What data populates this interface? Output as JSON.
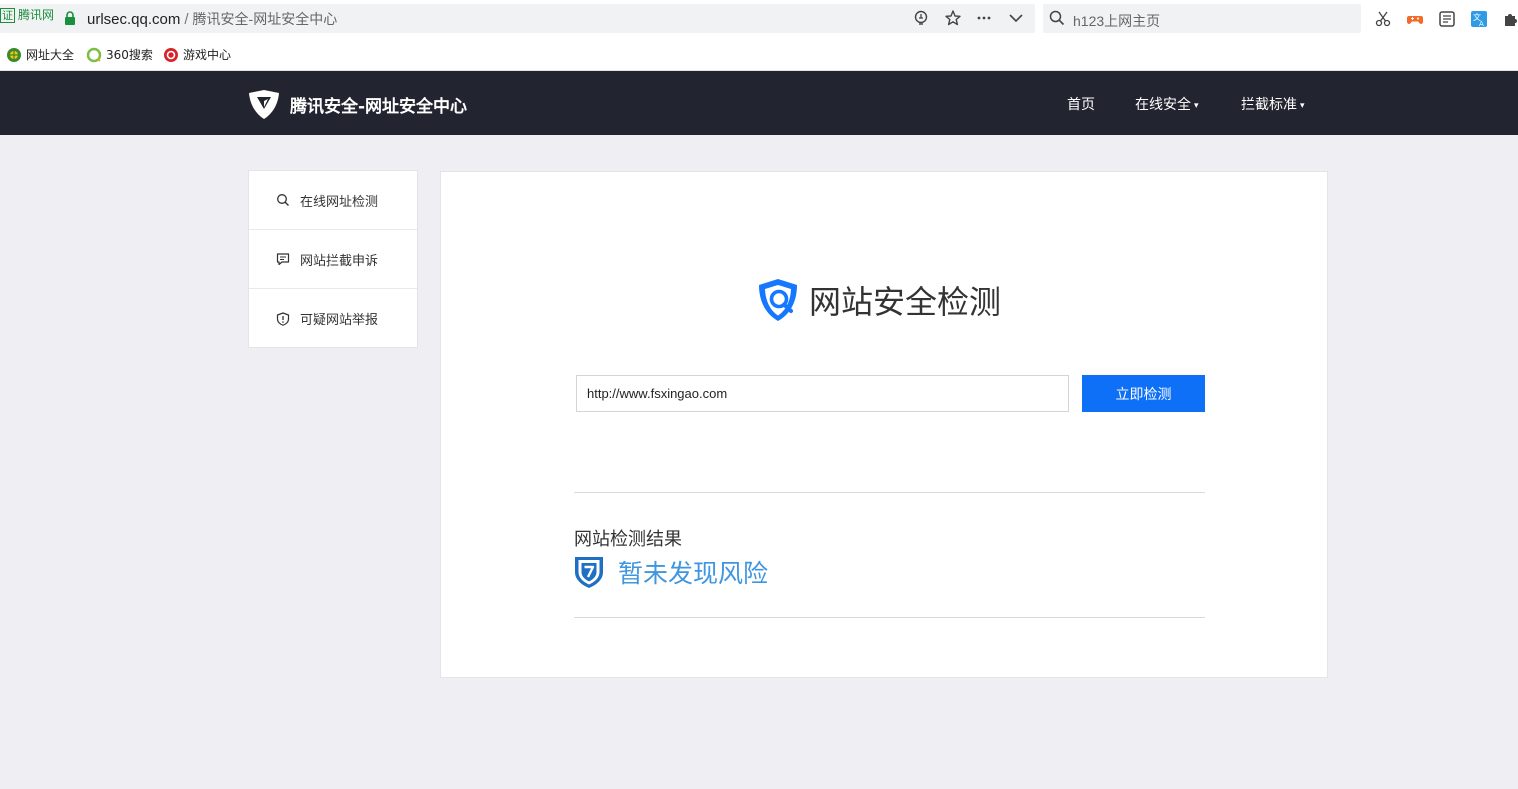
{
  "browser": {
    "cert_label": "腾讯网",
    "cert_box": "证",
    "url_domain": "urlsec.qq.com",
    "url_separator": "/",
    "page_title": "腾讯安全-网址安全中心",
    "search_placeholder": "h123上网主页"
  },
  "bookmarks": [
    {
      "label": "网址大全"
    },
    {
      "label": "360搜索"
    },
    {
      "label": "游戏中心"
    }
  ],
  "header": {
    "logo_text": "腾讯安全-网址安全中心",
    "nav": [
      {
        "label": "首页"
      },
      {
        "label": "在线安全"
      },
      {
        "label": "拦截标准"
      }
    ],
    "caret": "▾"
  },
  "sidebar": {
    "items": [
      {
        "label": "在线网址检测",
        "icon": "search-icon"
      },
      {
        "label": "网站拦截申诉",
        "icon": "comment-icon"
      },
      {
        "label": "可疑网站举报",
        "icon": "shield-alert-icon"
      }
    ]
  },
  "main": {
    "title": "网站安全检测",
    "input_value": "http://www.fsxingao.com",
    "check_button": "立即检测",
    "result_heading": "网站检测结果",
    "result_text": "暂未发现风险"
  },
  "colors": {
    "header_bg": "#22252f",
    "accent_blue": "#0e6ff7",
    "result_blue": "#3e95e0",
    "page_bg": "#efeff3"
  }
}
